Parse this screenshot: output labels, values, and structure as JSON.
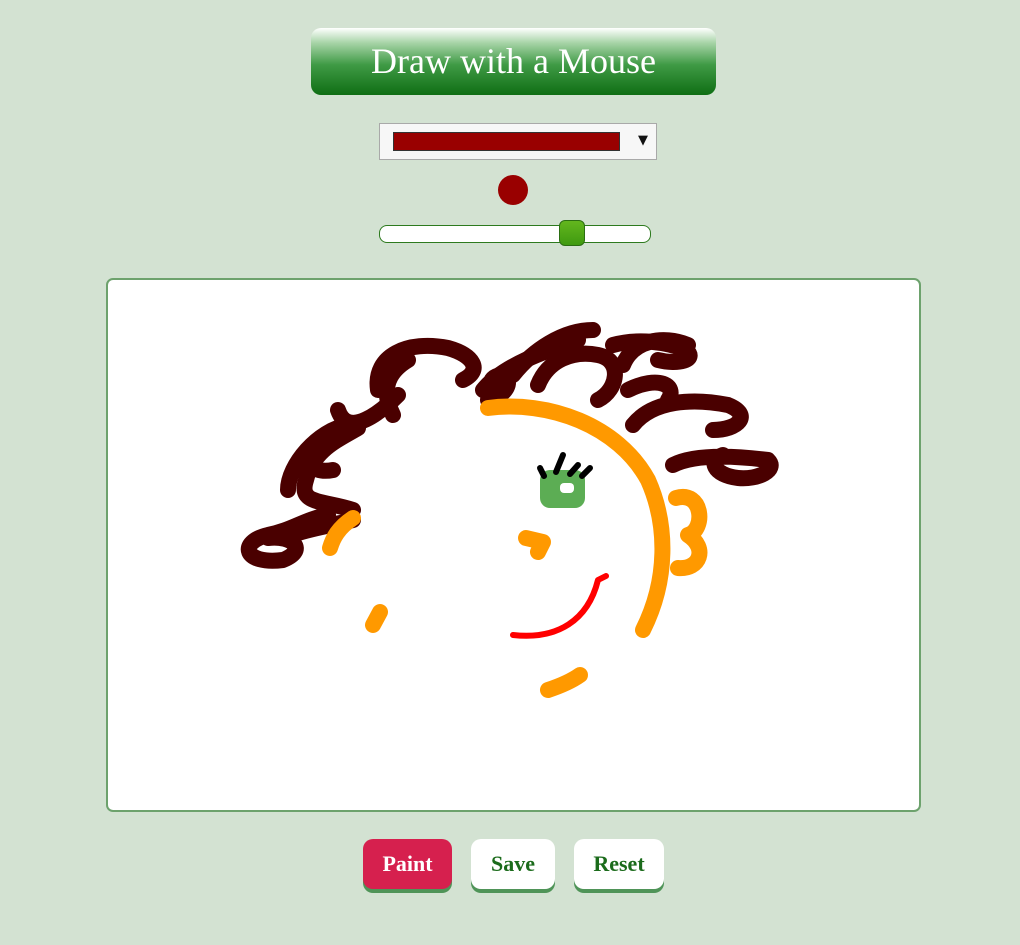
{
  "page": {
    "title": "Draw with a Mouse"
  },
  "controls": {
    "color_select": {
      "selected_color": "#990000"
    },
    "brush_preview_color": "#990000",
    "brush_size_fraction": 0.71
  },
  "drawing_colors": {
    "hair": "#4a0000",
    "face": "#ff9900",
    "eye": "#5cad54",
    "lashes": "#000000",
    "mouth": "#ff0000"
  },
  "buttons": {
    "paint": "Paint",
    "save": "Save",
    "reset": "Reset"
  }
}
